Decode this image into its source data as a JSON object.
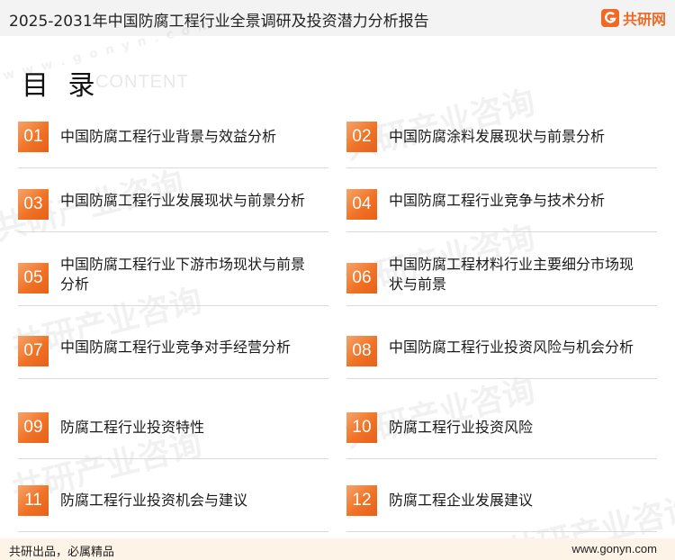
{
  "header": {
    "title": "2025-2031年中国防腐工程行业全景调研及投资潜力分析报告",
    "logo_text": "共研网",
    "logo_icon": "gonyn-logo-icon"
  },
  "toc": {
    "heading": "目 录",
    "subheading": "CONTENT",
    "items": [
      {
        "num": "01",
        "text": "中国防腐工程行业背景与效益分析"
      },
      {
        "num": "02",
        "text": "中国防腐涂料发展现状与前景分析"
      },
      {
        "num": "03",
        "text": "中国防腐工程行业发展现状与前景分析"
      },
      {
        "num": "04",
        "text": "中国防腐工程行业竞争与技术分析"
      },
      {
        "num": "05",
        "text": "中国防腐工程行业下游市场现状与前景分析"
      },
      {
        "num": "06",
        "text": "中国防腐工程材料行业主要细分市场现状与前景"
      },
      {
        "num": "07",
        "text": "中国防腐工程行业竞争对手经营分析"
      },
      {
        "num": "08",
        "text": "中国防腐工程行业投资风险与机会分析"
      },
      {
        "num": "09",
        "text": "防腐工程行业投资特性"
      },
      {
        "num": "10",
        "text": "防腐工程行业投资风险"
      },
      {
        "num": "11",
        "text": "防腐工程行业投资机会与建议"
      },
      {
        "num": "12",
        "text": "防腐工程企业发展建议"
      }
    ]
  },
  "watermark": {
    "text": "共研产业咨询",
    "url_text": "w w w . g o n y n . c o m"
  },
  "footer": {
    "left": "共研出品，必属精品",
    "right": "www.gonyn.com"
  },
  "colors": {
    "accent": "#f07225",
    "header_bg": "#f3f3f3",
    "footer_bg": "#fdf3e6"
  }
}
